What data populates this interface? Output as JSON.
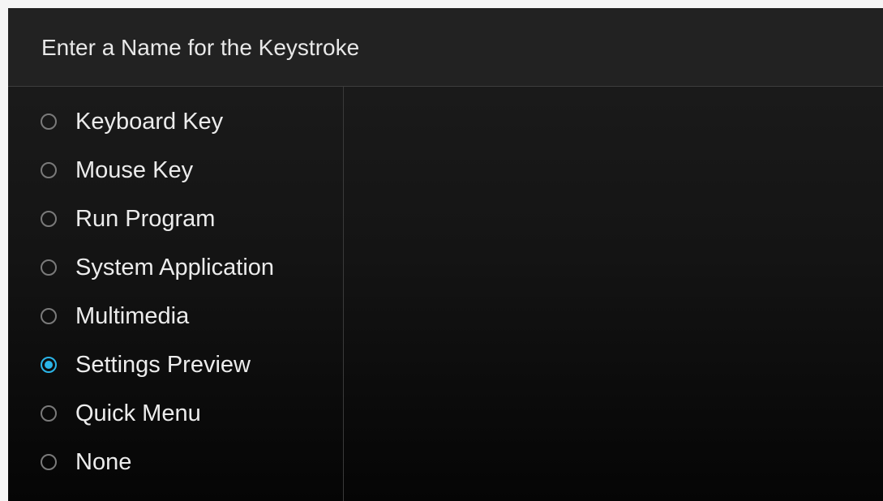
{
  "dialog": {
    "title": "Enter a Name for the Keystroke"
  },
  "options": [
    {
      "label": "Keyboard Key",
      "selected": false
    },
    {
      "label": "Mouse Key",
      "selected": false
    },
    {
      "label": "Run Program",
      "selected": false
    },
    {
      "label": "System Application",
      "selected": false
    },
    {
      "label": "Multimedia",
      "selected": false
    },
    {
      "label": "Settings Preview",
      "selected": true
    },
    {
      "label": "Quick Menu",
      "selected": false
    },
    {
      "label": "None",
      "selected": false
    }
  ],
  "colors": {
    "accent": "#2bb5e8",
    "header_bg": "#222222",
    "text": "#ececec"
  }
}
